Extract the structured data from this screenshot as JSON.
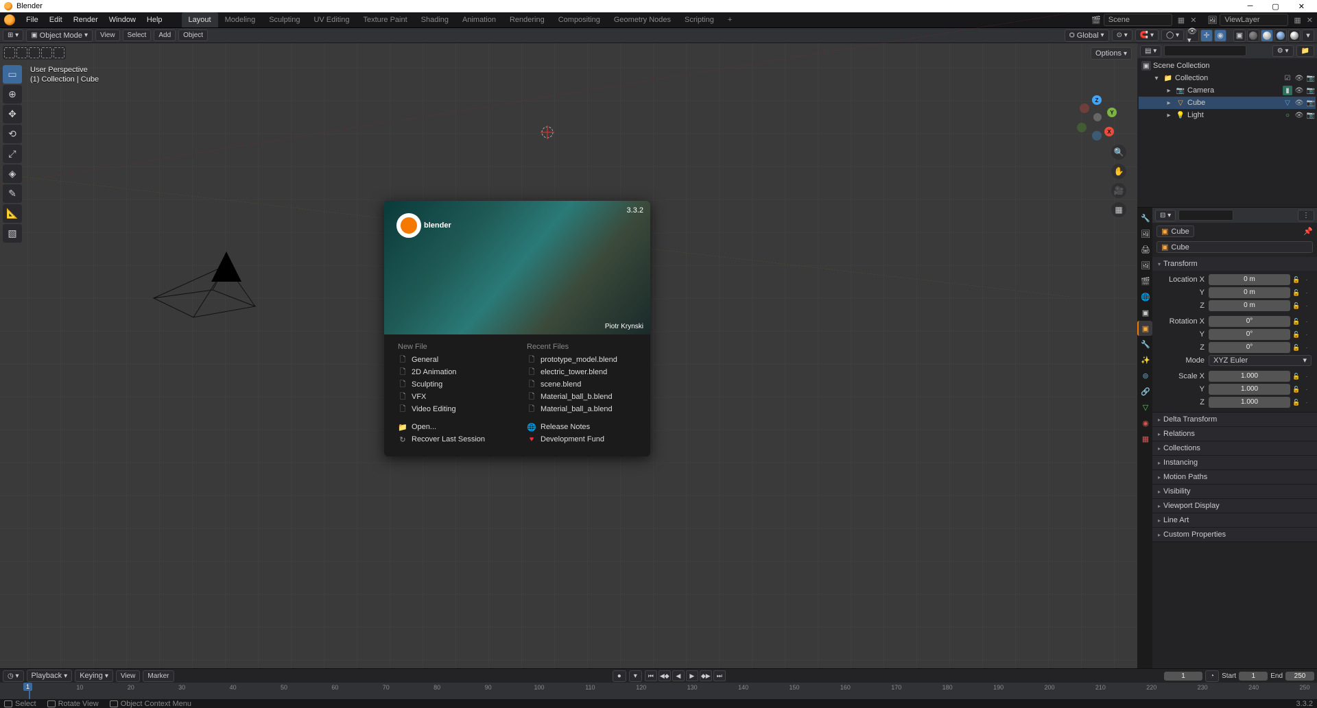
{
  "title": "Blender",
  "version_status": "3.3.2",
  "topmenu": [
    "File",
    "Edit",
    "Render",
    "Window",
    "Help"
  ],
  "workspaces": [
    "Layout",
    "Modeling",
    "Sculpting",
    "UV Editing",
    "Texture Paint",
    "Shading",
    "Animation",
    "Rendering",
    "Compositing",
    "Geometry Nodes",
    "Scripting"
  ],
  "active_workspace": "Layout",
  "scene_field": "Scene",
  "viewlayer_field": "ViewLayer",
  "header": {
    "mode": "Object Mode",
    "view": "View",
    "select": "Select",
    "add": "Add",
    "object": "Object",
    "orientation": "Global",
    "options": "Options"
  },
  "viewport_info": {
    "l1": "User Perspective",
    "l2": "(1) Collection | Cube"
  },
  "splash": {
    "version": "3.3.2",
    "credit": "Piotr Krynski",
    "new_file_h": "New File",
    "recent_h": "Recent Files",
    "new_files": [
      "General",
      "2D Animation",
      "Sculpting",
      "VFX",
      "Video Editing"
    ],
    "recent_files": [
      "prototype_model.blend",
      "electric_tower.blend",
      "scene.blend",
      "Material_ball_b.blend",
      "Material_ball_a.blend"
    ],
    "open": "Open...",
    "recover": "Recover Last Session",
    "release": "Release Notes",
    "devfund": "Development Fund"
  },
  "outliner": {
    "root": "Scene Collection",
    "coll": "Collection",
    "items": [
      {
        "name": "Camera",
        "type": "camera"
      },
      {
        "name": "Cube",
        "type": "mesh"
      },
      {
        "name": "Light",
        "type": "light"
      }
    ]
  },
  "properties": {
    "active": "Cube",
    "bc_cube": "Cube",
    "panels": {
      "transform": "Transform",
      "delta": "Delta Transform",
      "relations": "Relations",
      "collections": "Collections",
      "instancing": "Instancing",
      "motion": "Motion Paths",
      "visibility": "Visibility",
      "vpdisp": "Viewport Display",
      "lineart": "Line Art",
      "custom": "Custom Properties"
    },
    "transform": {
      "location": {
        "label": "Location X",
        "x": "0 m",
        "y": "0 m",
        "z": "0 m"
      },
      "rotation": {
        "label": "Rotation X",
        "x": "0°",
        "y": "0°",
        "z": "0°"
      },
      "scale": {
        "label": "Scale X",
        "x": "1.000",
        "y": "1.000",
        "z": "1.000"
      },
      "mode_label": "Mode",
      "mode": "XYZ Euler",
      "y": "Y",
      "z": "Z"
    }
  },
  "timeline": {
    "playback": "Playback",
    "keying": "Keying",
    "view": "View",
    "marker": "Marker",
    "current": "1",
    "start_l": "Start",
    "start": "1",
    "end_l": "End",
    "end": "250",
    "ticks": [
      10,
      20,
      30,
      40,
      50,
      60,
      70,
      80,
      90,
      100,
      110,
      120,
      130,
      140,
      150,
      160,
      170,
      180,
      190,
      200,
      210,
      220,
      230,
      240,
      250
    ]
  },
  "status": {
    "select": "Select",
    "rotate": "Rotate View",
    "ctx": "Object Context Menu"
  }
}
